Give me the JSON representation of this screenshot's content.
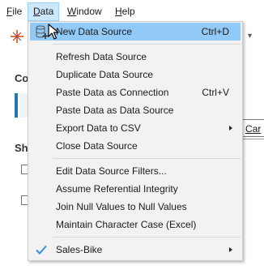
{
  "menubar": {
    "items": [
      {
        "label": "File",
        "mnemonic": "F"
      },
      {
        "label": "Data",
        "mnemonic": "D"
      },
      {
        "label": "Window",
        "mnemonic": "W"
      },
      {
        "label": "Help",
        "mnemonic": "H"
      }
    ],
    "active": "Data"
  },
  "background": {
    "section_co": "Co",
    "section_sh": "Sh",
    "partial_button": "Car"
  },
  "data_menu": {
    "items": [
      {
        "label": "New Data Source",
        "shortcut": "Ctrl+D",
        "highlighted": true,
        "icon": "new-data-source-icon"
      },
      {
        "label": "Refresh Data Source",
        "shortcut": ""
      },
      {
        "label": "Duplicate Data Source",
        "shortcut": ""
      },
      {
        "label": "Paste Data as Connection",
        "shortcut": "Ctrl+V"
      },
      {
        "label": "Paste Data as Data Source",
        "shortcut": ""
      },
      {
        "label": "Export Data to CSV",
        "shortcut": "",
        "submenu": true
      },
      {
        "label": "Close Data Source",
        "shortcut": ""
      },
      {
        "label": "Edit Data Source Filters...",
        "shortcut": ""
      },
      {
        "label": "Assume Referential Integrity",
        "shortcut": ""
      },
      {
        "label": "Join Null Values to Null Values",
        "shortcut": ""
      },
      {
        "label": "Maintain Character Case (Excel)",
        "shortcut": ""
      },
      {
        "label": "Sales-Bike",
        "shortcut": "",
        "submenu": true,
        "checked": true,
        "icon": "check-icon"
      }
    ]
  },
  "colors": {
    "highlight": "#91c9f7",
    "menu_bg": "#f2f2f2",
    "active_menubar": "#cce8ff",
    "check": "#3a8ee6"
  }
}
